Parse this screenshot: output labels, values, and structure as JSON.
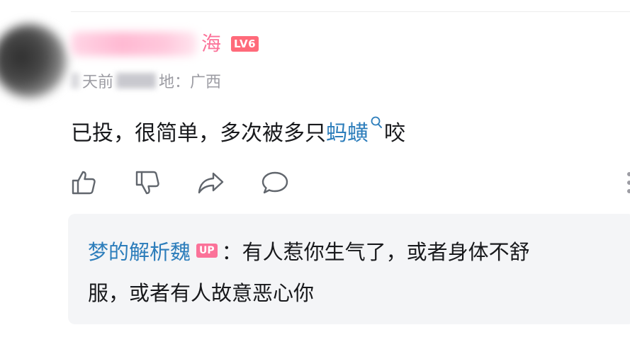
{
  "user": {
    "name_visible": "海",
    "level_badge": "LV6"
  },
  "meta": {
    "time_fragment": "天前",
    "location": "地：广西"
  },
  "comment": {
    "text_before": "已投，很简单，多次被多只",
    "keyword": "蚂蟥",
    "text_after": "咬"
  },
  "actions": {
    "like_icon": "thumbs-up-icon",
    "dislike_icon": "thumbs-down-icon",
    "share_icon": "share-icon",
    "reply_icon": "comment-bubble-icon"
  },
  "reply": {
    "author": "梦的解析魏",
    "up_badge": "UP",
    "line1": "：有人惹你生气了，或者身体不舒",
    "line2": "服，或者有人故意恶心你"
  },
  "colors": {
    "accent_pink": "#fb7299",
    "link_blue": "#2c7dbb",
    "meta_gray": "#9c9ca3",
    "reply_bg": "#f4f5f7"
  }
}
